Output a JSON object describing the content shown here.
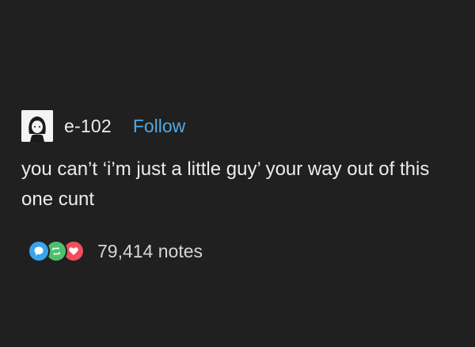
{
  "post": {
    "username": "e-102",
    "follow_label": "Follow",
    "text": "you can’t ‘i’m just a little guy’ your way out of this one cunt",
    "notes": "79,414 notes"
  },
  "icons": {
    "avatar": "avatar-image",
    "reply": "speech-bubble-icon",
    "reblog": "reblog-arrows-icon",
    "like": "heart-icon"
  },
  "colors": {
    "background": "#202020",
    "follow": "#52a8e6",
    "reply": "#3aa4e8",
    "reblog": "#4ec06d",
    "like": "#f04e5c"
  }
}
